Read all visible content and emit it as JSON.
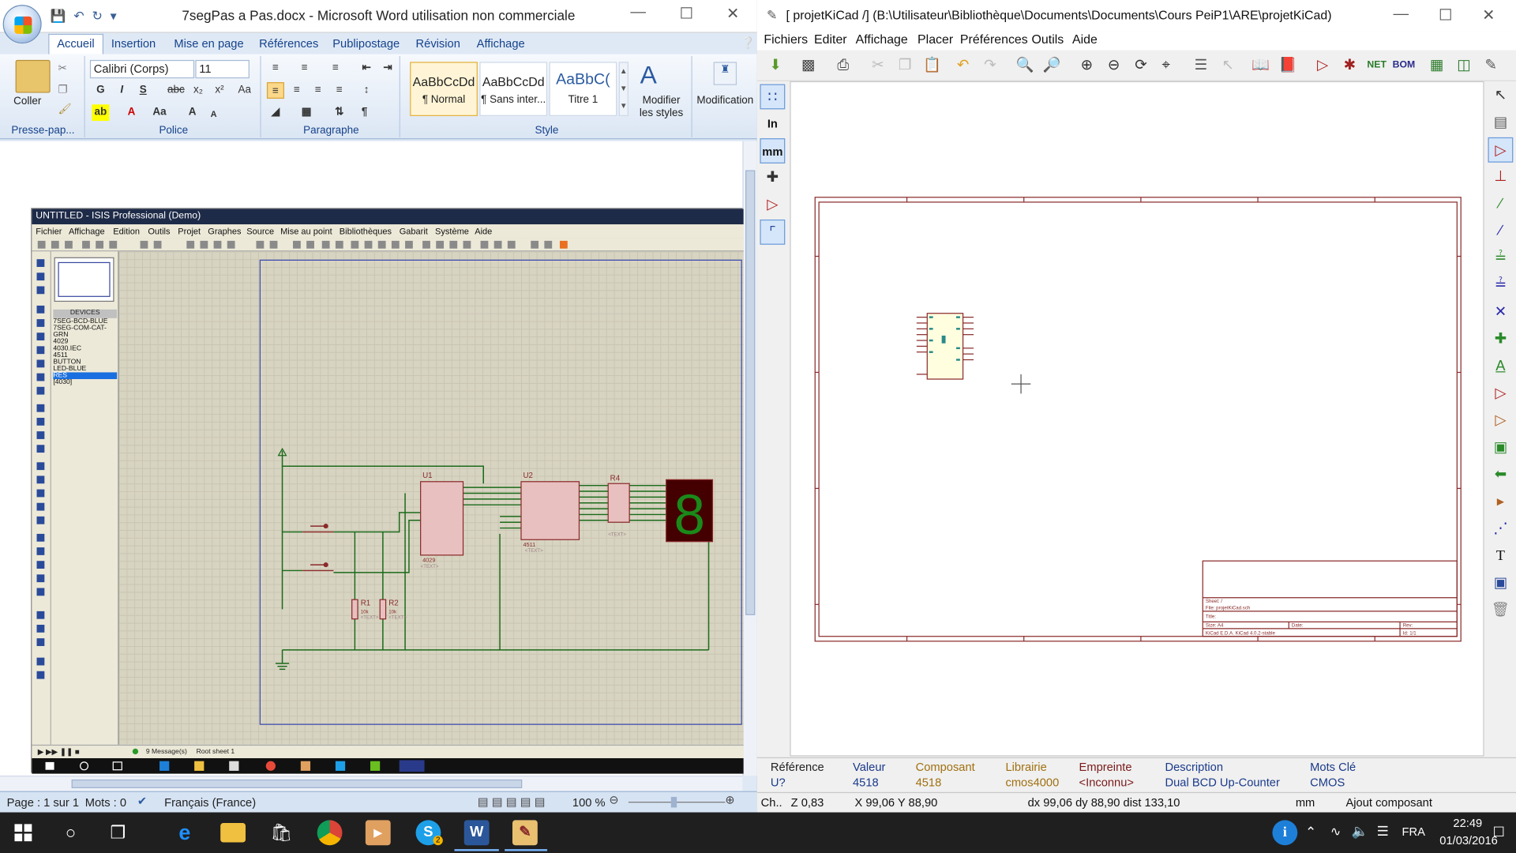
{
  "word": {
    "title": "7segPas a Pas.docx - Microsoft Word utilisation non commerciale",
    "tabs": [
      "Accueil",
      "Insertion",
      "Mise en page",
      "Références",
      "Publipostage",
      "Révision",
      "Affichage"
    ],
    "groups": {
      "clipboard": "Presse-pap...",
      "font": "Police",
      "paragraph": "Paragraphe",
      "style": "Style"
    },
    "paste_label": "Coller",
    "font_name": "Calibri (Corps)",
    "font_size": "11",
    "styles": [
      {
        "preview": "AaBbCcDd",
        "name": "¶ Normal"
      },
      {
        "preview": "AaBbCcDd",
        "name": "¶ Sans inter..."
      },
      {
        "preview": "AaBbC(",
        "name": "Titre 1"
      }
    ],
    "modify_styles": "Modifier les styles",
    "modification": "Modification",
    "status": {
      "page": "Page : 1 sur 1",
      "words": "Mots : 0",
      "language": "Français (France)",
      "zoom": "100 %"
    }
  },
  "isis": {
    "title": "UNTITLED - ISIS Professional (Demo)",
    "menu": [
      "Fichier",
      "Affichage",
      "Edition",
      "Outils",
      "Projet",
      "Graphes",
      "Source",
      "Mise au point",
      "Bibliothèques",
      "Gabarit",
      "Système",
      "Aide"
    ],
    "devices_header": "DEVICES",
    "devices": [
      "7SEG-BCD-BLUE",
      "7SEG-COM-CAT-GRN",
      "4029",
      "4030.IEC",
      "4511",
      "BUTTON",
      "LED-BLUE",
      "RES",
      "[4030]"
    ],
    "selected_device": "RES",
    "status_messages": "9 Message(s)",
    "status_sheet": "Root sheet 1",
    "components": {
      "u1": "U1",
      "u1_part": "4029",
      "u2": "U2",
      "u2_part": "4511",
      "r4": "R4",
      "r1": "R1",
      "r2": "R2",
      "r_val": "10k",
      "text_tag": "<TEXT>",
      "seg_digit": "8"
    }
  },
  "kicad": {
    "title": "[ projetKiCad /] (B:\\Utilisateur\\Bibliothèque\\Documents\\Documents\\Cours PeiP1\\ARE\\projetKiCad)",
    "menu": [
      "Fichiers",
      "Editer",
      "Affichage",
      "Placer",
      "Préférences",
      "Outils",
      "Aide"
    ],
    "left_tools": {
      "inch": "In",
      "mm": "mm"
    },
    "titleblock": {
      "sheet": "Sheet: /",
      "file": "File: projetKiCad.sch",
      "title": "Title:",
      "size": "Size: A4",
      "date": "Date:",
      "rev": "Rev:",
      "kicad": "KiCad E.D.A.  KiCad 4.0.2-stable",
      "id": "Id: 1/1"
    },
    "info": [
      {
        "header": "Référence",
        "value": "U?",
        "color": "#1a3a8a"
      },
      {
        "header": "Valeur",
        "value": "4518",
        "color": "#1a3a8a"
      },
      {
        "header": "Composant",
        "value": "4518",
        "color": "#a07010"
      },
      {
        "header": "Librairie",
        "value": "cmos4000",
        "color": "#a07010"
      },
      {
        "header": "Empreinte",
        "value": "<Inconnu>",
        "color": "#7a1a1a"
      },
      {
        "header": "Description",
        "value": "Dual BCD Up-Counter",
        "color": "#1a3a8a"
      },
      {
        "header": "Mots Clé",
        "value": "CMOS",
        "color": "#1a3a8a"
      }
    ],
    "status": {
      "ch": "Ch..",
      "zoom": "Z 0,83",
      "xy": "X 99,06  Y 88,90",
      "delta": "dx 99,06  dy 88,90  dist 133,10",
      "unit": "mm",
      "mode": "Ajout composant"
    }
  },
  "taskbar": {
    "time": "22:49",
    "date": "01/03/2016",
    "lang": "FRA",
    "skype_badge": "2"
  }
}
